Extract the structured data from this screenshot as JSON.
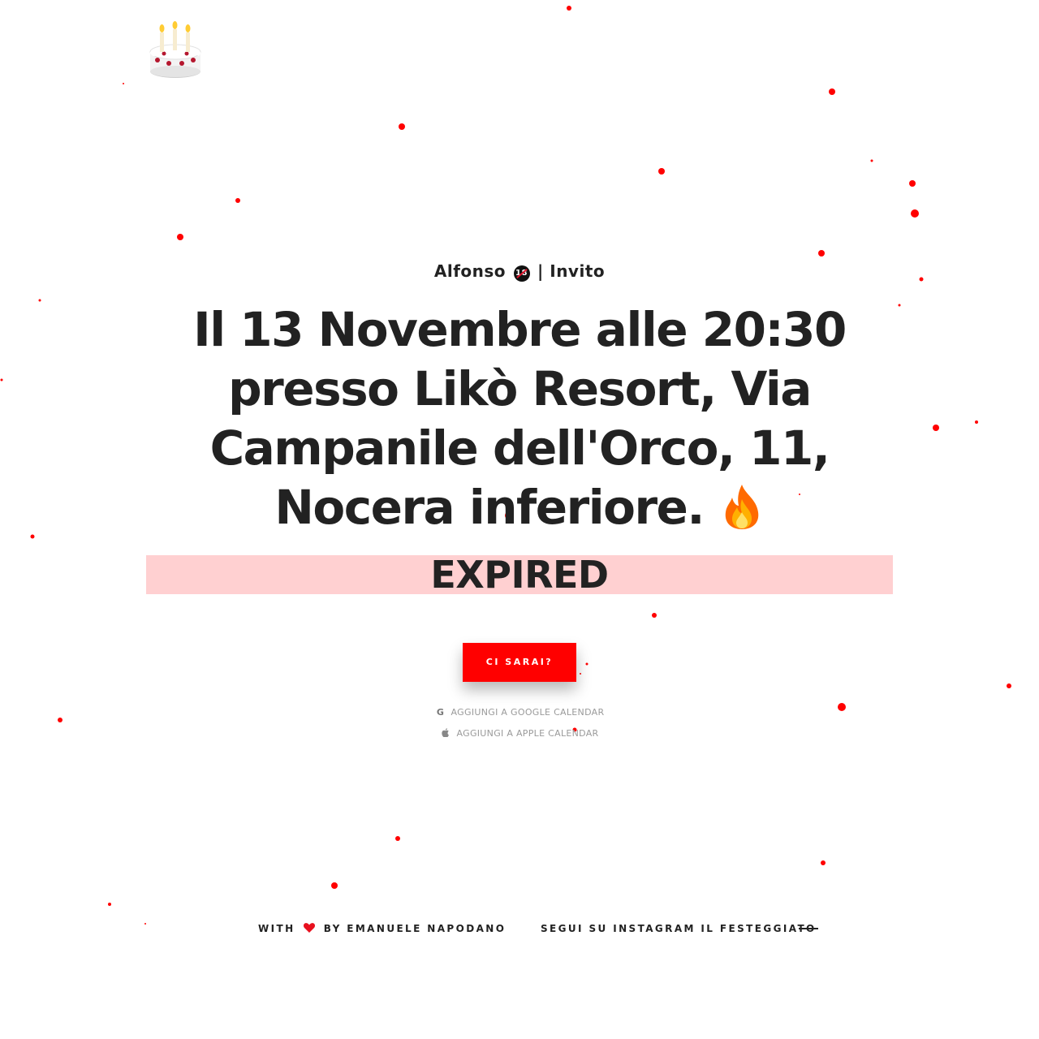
{
  "header": {
    "logo_icon": "birthday-cake-icon"
  },
  "invite": {
    "name": "Alfonso",
    "age_badge": "18",
    "separator": "|",
    "label": "Invito",
    "headline": "Il 13 Novembre alle 20:30 presso Likò Resort, Via Campanile dell'Orco, 11, Nocera inferiore.",
    "headline_icon": "fire-icon"
  },
  "countdown": {
    "status": "EXPIRED",
    "bar_color": "#ffd0d1"
  },
  "actions": {
    "rsvp_label": "CI SARAI?",
    "rsvp_color": "#ff0000",
    "google_calendar_label": "AGGIUNGI A GOOGLE CALENDAR",
    "google_icon": "google-icon",
    "apple_calendar_label": "AGGIUNGI A APPLE CALENDAR",
    "apple_icon": "apple-icon"
  },
  "footer": {
    "credit_prefix": "WITH",
    "credit_suffix": "BY EMANUELE NAPODANO",
    "heart_icon": "heart-icon",
    "instagram_label": "SEGUI SU INSTAGRAM IL FESTEGGIATO"
  },
  "decoration": {
    "confetti_color": "#ff0000"
  }
}
